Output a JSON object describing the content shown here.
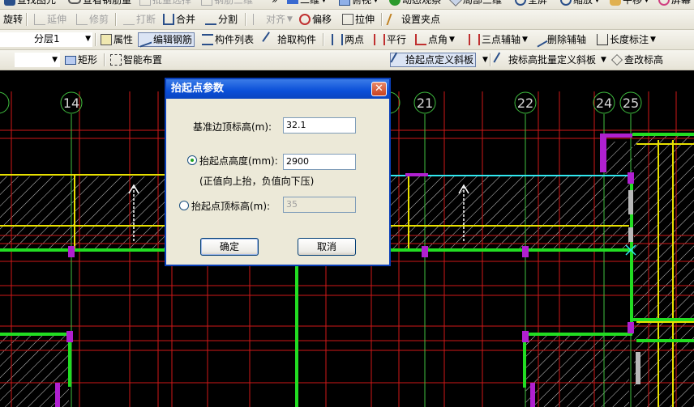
{
  "toolbar_row0": {
    "items": [
      "查找图元",
      "查看钢筋量",
      "批量选择",
      "钢筋三维",
      "二维",
      "俯视",
      "动态观察",
      "局部三维",
      "全屏",
      "缩放",
      "平移",
      "屏幕"
    ]
  },
  "toolbar_row1": {
    "items": [
      "旋转",
      "延伸",
      "修剪",
      "打断",
      "合并",
      "分割",
      "对齐",
      "偏移",
      "拉伸",
      "设置夹点"
    ]
  },
  "toolbar_row2": {
    "layer_combo": "分层1",
    "items": [
      "属性",
      "编辑钢筋",
      "构件列表",
      "拾取构件",
      "两点",
      "平行",
      "点角",
      "三点辅轴",
      "删除辅轴",
      "长度标注"
    ]
  },
  "toolbar_row3": {
    "combo_value": "",
    "items": [
      "矩形",
      "智能布置",
      "拾起点定义斜板",
      "按标高批量定义斜板",
      "查改标高"
    ]
  },
  "axes": [
    "14",
    "21",
    "22",
    "24",
    "25"
  ],
  "dialog": {
    "title": "抬起点参数",
    "base_top_label": "基准边顶标高(m):",
    "base_top_value": "32.1",
    "raise_height_label": "抬起点高度(mm):",
    "raise_height_value": "2900",
    "hint": "(正值向上抬，负值向下压)",
    "raise_top_label": "抬起点顶标高(m):",
    "raise_top_value": "35",
    "ok": "确定",
    "cancel": "取消",
    "selected_option": "raise_height"
  },
  "colors": {
    "grid_red": "#d01818",
    "beam_green": "#22dd22",
    "wall_yellow": "#e8e000",
    "purple": "#b020d0",
    "cyan": "#30e8f0",
    "dialog_title": "#0a4fd8"
  }
}
